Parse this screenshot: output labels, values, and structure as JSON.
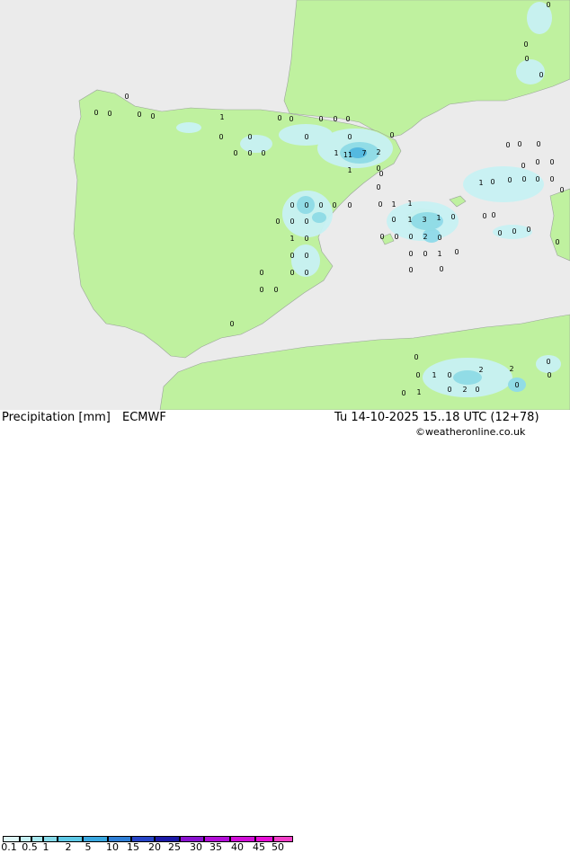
{
  "header_left": {
    "title": "Precipitation [mm]",
    "model": "ECMWF"
  },
  "header_right": {
    "valid_time": "Tu 14-10-2025 15..18 UTC (12+78)",
    "credit": "©weatheronline.co.uk"
  },
  "colorbar": {
    "ticks": [
      "0.1",
      "0.5",
      "1",
      "2",
      "5",
      "10",
      "15",
      "20",
      "25",
      "30",
      "35",
      "40",
      "45",
      "50"
    ],
    "colors": [
      "#dff7f7",
      "#c5f0f3",
      "#a8e8ef",
      "#87dbea",
      "#5ec9e6",
      "#3aa8e0",
      "#2f7fd6",
      "#2746c8",
      "#1c1aa8",
      "#8a12d0",
      "#b30fd8",
      "#d10fd8",
      "#e80fd8",
      "#f23fc8"
    ]
  },
  "colors": {
    "land": "#bff19f",
    "sea": "#ebebeb",
    "light_precip": "#c8f2f4",
    "mid_precip": "#8fdbea",
    "heavy_precip": "#4fb7e4"
  },
  "precip_labels": [
    {
      "t": "0"
    },
    {
      "t": "0"
    },
    {
      "t": "0"
    },
    {
      "t": "0"
    },
    {
      "t": "0"
    },
    {
      "t": "1"
    },
    {
      "t": "0"
    },
    {
      "t": "0"
    },
    {
      "t": "0"
    },
    {
      "t": "0"
    },
    {
      "t": "0"
    },
    {
      "t": "0"
    },
    {
      "t": "0"
    },
    {
      "t": "0"
    },
    {
      "t": "0"
    },
    {
      "t": "0"
    },
    {
      "t": "0"
    },
    {
      "t": "0"
    },
    {
      "t": "0"
    },
    {
      "t": "1"
    },
    {
      "t": "11"
    },
    {
      "t": "7"
    },
    {
      "t": "2"
    },
    {
      "t": "1"
    },
    {
      "t": "0"
    },
    {
      "t": "0"
    },
    {
      "t": "0"
    },
    {
      "t": "0"
    },
    {
      "t": "0"
    },
    {
      "t": "0"
    },
    {
      "t": "0"
    },
    {
      "t": "0"
    },
    {
      "t": "1"
    },
    {
      "t": "1"
    },
    {
      "t": "0"
    },
    {
      "t": "0"
    },
    {
      "t": "0"
    },
    {
      "t": "1"
    },
    {
      "t": "0"
    },
    {
      "t": "0"
    },
    {
      "t": "0"
    },
    {
      "t": "0"
    },
    {
      "t": "0"
    },
    {
      "t": "0"
    },
    {
      "t": "0"
    },
    {
      "t": "0"
    },
    {
      "t": "0"
    },
    {
      "t": "1"
    },
    {
      "t": "3"
    },
    {
      "t": "1"
    },
    {
      "t": "0"
    },
    {
      "t": "0"
    },
    {
      "t": "0"
    },
    {
      "t": "0"
    },
    {
      "t": "0"
    },
    {
      "t": "2"
    },
    {
      "t": "0"
    },
    {
      "t": "0"
    },
    {
      "t": "0"
    },
    {
      "t": "1"
    },
    {
      "t": "0"
    },
    {
      "t": "0"
    },
    {
      "t": "0"
    },
    {
      "t": "0"
    },
    {
      "t": "0"
    },
    {
      "t": "0"
    },
    {
      "t": "0"
    },
    {
      "t": "1"
    },
    {
      "t": "0"
    },
    {
      "t": "0"
    },
    {
      "t": "0"
    },
    {
      "t": "0"
    },
    {
      "t": "0"
    },
    {
      "t": "0"
    },
    {
      "t": "0"
    },
    {
      "t": "0"
    },
    {
      "t": "0"
    },
    {
      "t": "0"
    },
    {
      "t": "0"
    },
    {
      "t": "0"
    },
    {
      "t": "0"
    },
    {
      "t": "0"
    },
    {
      "t": "0"
    },
    {
      "t": "0"
    },
    {
      "t": "0"
    },
    {
      "t": "0"
    },
    {
      "t": "0"
    },
    {
      "t": "1"
    },
    {
      "t": "0"
    },
    {
      "t": "2"
    },
    {
      "t": "2"
    },
    {
      "t": "0"
    },
    {
      "t": "1"
    },
    {
      "t": "0"
    },
    {
      "t": "2"
    },
    {
      "t": "0"
    },
    {
      "t": "0"
    },
    {
      "t": "0"
    },
    {
      "t": "0"
    },
    {
      "t": "0"
    },
    {
      "t": "0"
    }
  ]
}
